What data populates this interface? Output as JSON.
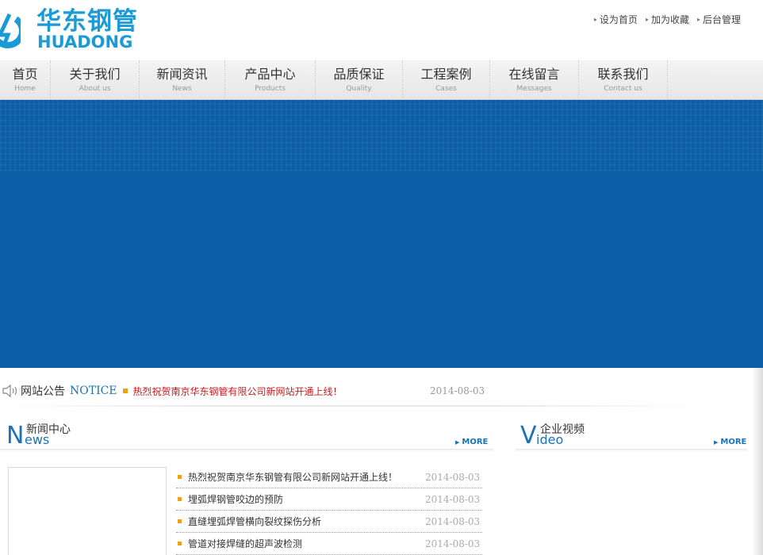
{
  "header": {
    "logo_cn": "华东钢管",
    "logo_en": "HUADONG",
    "toplinks": [
      {
        "label": "设为首页"
      },
      {
        "label": "加为收藏"
      },
      {
        "label": "后台管理"
      }
    ]
  },
  "nav": {
    "items": [
      {
        "cn": "首页",
        "en": "Home"
      },
      {
        "cn": "关于我们",
        "en": "About us"
      },
      {
        "cn": "新闻资讯",
        "en": "News"
      },
      {
        "cn": "产品中心",
        "en": "Products"
      },
      {
        "cn": "品质保证",
        "en": "Quality"
      },
      {
        "cn": "工程案例",
        "en": "Cases"
      },
      {
        "cn": "在线留言",
        "en": "Messages"
      },
      {
        "cn": "联系我们",
        "en": "Contact us"
      }
    ]
  },
  "colors": {
    "brand": "#1a9ad6",
    "banner": "#0a5ea5",
    "accent_link": "#1a73b8",
    "notice_red": "#d3151b",
    "bullet": "#f0a010"
  },
  "notice": {
    "title": "网站公告",
    "title_en": "NOTICE",
    "text": "热烈祝贺南京华东钢管有限公司新网站开通上线！",
    "date": "2014-08-03"
  },
  "news_section": {
    "big_letter": "N",
    "cn": "新闻中心",
    "en_rest": "ews",
    "more": "MORE",
    "items": [
      {
        "title": "热烈祝贺南京华东钢管有限公司新网站开通上线！",
        "date": "2014-08-03"
      },
      {
        "title": "埋弧焊钢管咬边的预防",
        "date": "2014-08-03"
      },
      {
        "title": "直缝埋弧焊管横向裂纹探伤分析",
        "date": "2014-08-03"
      },
      {
        "title": "管道对接焊缝的超声波检测",
        "date": "2014-08-03"
      }
    ]
  },
  "video_section": {
    "big_letter": "V",
    "cn": "企业视频",
    "en_rest": "ideo",
    "more": "MORE"
  },
  "icons": {
    "speaker": "speaker-icon",
    "more_arrow": "triangle-right-icon"
  }
}
